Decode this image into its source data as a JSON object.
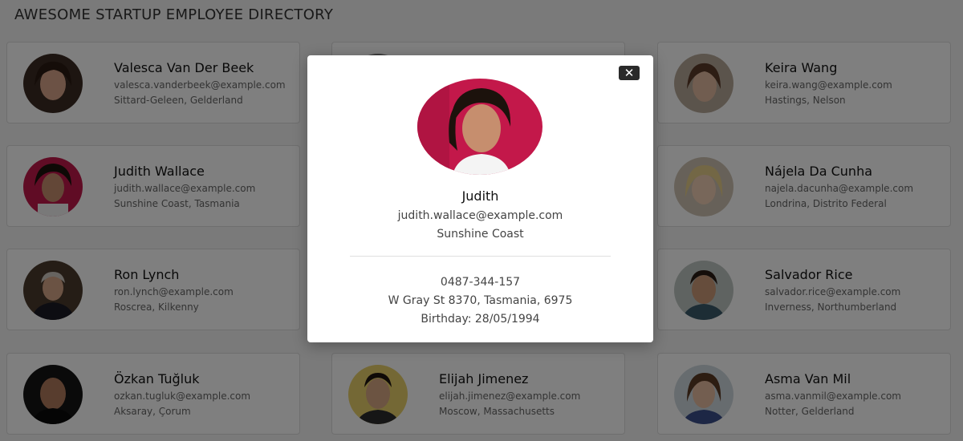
{
  "header": {
    "title": "AWESOME STARTUP EMPLOYEE DIRECTORY"
  },
  "employees": [
    {
      "name": "Valesca Van Der Beek",
      "email": "valesca.vanderbeek@example.com",
      "location": "Sittard-Geleen, Gelderland"
    },
    {
      "name": "",
      "email": "",
      "location": ""
    },
    {
      "name": "Keira Wang",
      "email": "keira.wang@example.com",
      "location": "Hastings, Nelson"
    },
    {
      "name": "Judith Wallace",
      "email": "judith.wallace@example.com",
      "location": "Sunshine Coast, Tasmania"
    },
    {
      "name": "",
      "email": "",
      "location": ""
    },
    {
      "name": "Nájela Da Cunha",
      "email": "najela.dacunha@example.com",
      "location": "Londrina, Distrito Federal"
    },
    {
      "name": "Ron Lynch",
      "email": "ron.lynch@example.com",
      "location": "Roscrea, Kilkenny"
    },
    {
      "name": "",
      "email": "",
      "location": ""
    },
    {
      "name": "Salvador Rice",
      "email": "salvador.rice@example.com",
      "location": "Inverness, Northumberland"
    },
    {
      "name": "Özkan Tuğluk",
      "email": "ozkan.tugluk@example.com",
      "location": "Aksaray, Çorum"
    },
    {
      "name": "Elijah Jimenez",
      "email": "elijah.jimenez@example.com",
      "location": "Moscow, Massachusetts"
    },
    {
      "name": "Asma Van Mil",
      "email": "asma.vanmil@example.com",
      "location": "Notter, Gelderland"
    }
  ],
  "modal": {
    "name": "Judith",
    "email": "judith.wallace@example.com",
    "city": "Sunshine Coast",
    "phone": "0487-344-157",
    "address": "W Gray St 8370, Tasmania, 6975",
    "birthday": "Birthday: 28/05/1994",
    "close_label": "✕"
  }
}
